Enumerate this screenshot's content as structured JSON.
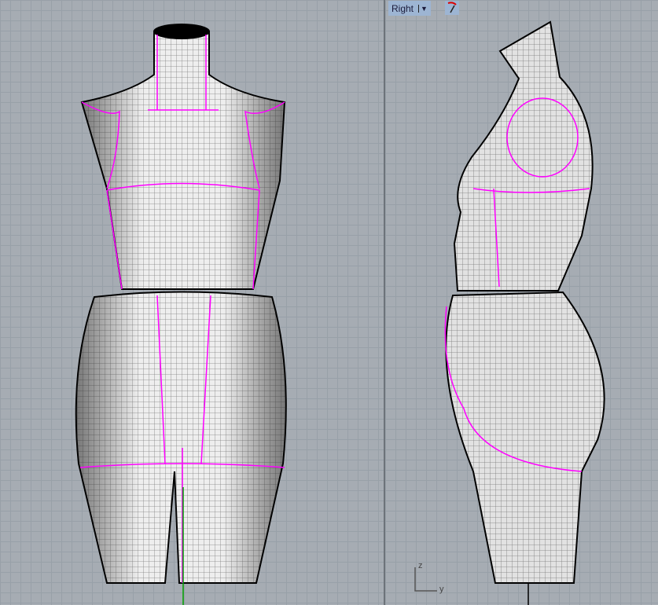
{
  "right_viewport": {
    "title": "Right",
    "dropdown_icon": "chevron-down-icon",
    "gumball_icon": "gumball-icon",
    "axes": {
      "vertical": "z",
      "horizontal": "y"
    }
  },
  "colors": {
    "background": "#a6acb3",
    "grid": "#98a0a8",
    "seam": "#ff00ff",
    "surface": "#e4e4e4",
    "mesh": "#111111",
    "z_axis": "#00a000"
  }
}
